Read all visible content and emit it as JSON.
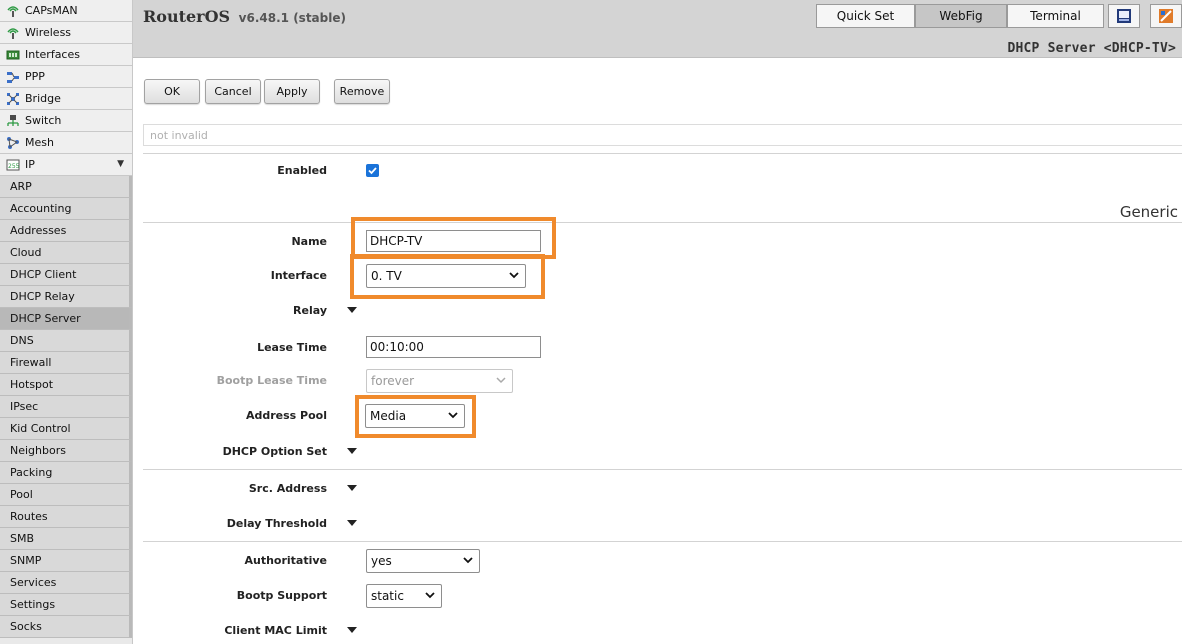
{
  "sidebar": {
    "top_items": [
      {
        "label": "CAPsMAN"
      },
      {
        "label": "Wireless"
      },
      {
        "label": "Interfaces"
      },
      {
        "label": "PPP"
      },
      {
        "label": "Bridge"
      },
      {
        "label": "Switch"
      },
      {
        "label": "Mesh"
      },
      {
        "label": "IP"
      }
    ],
    "ip_submenu": [
      "ARP",
      "Accounting",
      "Addresses",
      "Cloud",
      "DHCP Client",
      "DHCP Relay",
      "DHCP Server",
      "DNS",
      "Firewall",
      "Hotspot",
      "IPsec",
      "Kid Control",
      "Neighbors",
      "Packing",
      "Pool",
      "Routes",
      "SMB",
      "SNMP",
      "Services",
      "Settings",
      "Socks"
    ],
    "active_item": "DHCP Server"
  },
  "header": {
    "brand": "RouterOS",
    "version": "v6.48.1 (stable)",
    "nav": {
      "quick_set": "Quick Set",
      "webfig": "WebFig",
      "terminal": "Terminal"
    },
    "active_nav": "WebFig",
    "page_title": "DHCP Server <DHCP-TV>"
  },
  "toolbar": {
    "ok": "OK",
    "cancel": "Cancel",
    "apply": "Apply",
    "remove": "Remove"
  },
  "status": {
    "text": "not invalid"
  },
  "form": {
    "enabled": {
      "label": "Enabled",
      "checked": true
    },
    "section_title": "Generic",
    "name": {
      "label": "Name",
      "value": "DHCP-TV"
    },
    "interface": {
      "label": "Interface",
      "value": "0. TV"
    },
    "relay": {
      "label": "Relay"
    },
    "lease_time": {
      "label": "Lease Time",
      "value": "00:10:00"
    },
    "bootp_lease_time": {
      "label": "Bootp Lease Time",
      "value": "forever"
    },
    "address_pool": {
      "label": "Address Pool",
      "value": "Media"
    },
    "dhcp_option_set": {
      "label": "DHCP Option Set"
    },
    "src_address": {
      "label": "Src. Address"
    },
    "delay_threshold": {
      "label": "Delay Threshold"
    },
    "authoritative": {
      "label": "Authoritative",
      "value": "yes"
    },
    "bootp_support": {
      "label": "Bootp Support",
      "value": "static"
    },
    "client_mac_limit": {
      "label": "Client MAC Limit"
    }
  },
  "colors": {
    "highlight": "#f08a2c",
    "checkbox": "#1a73d9"
  }
}
